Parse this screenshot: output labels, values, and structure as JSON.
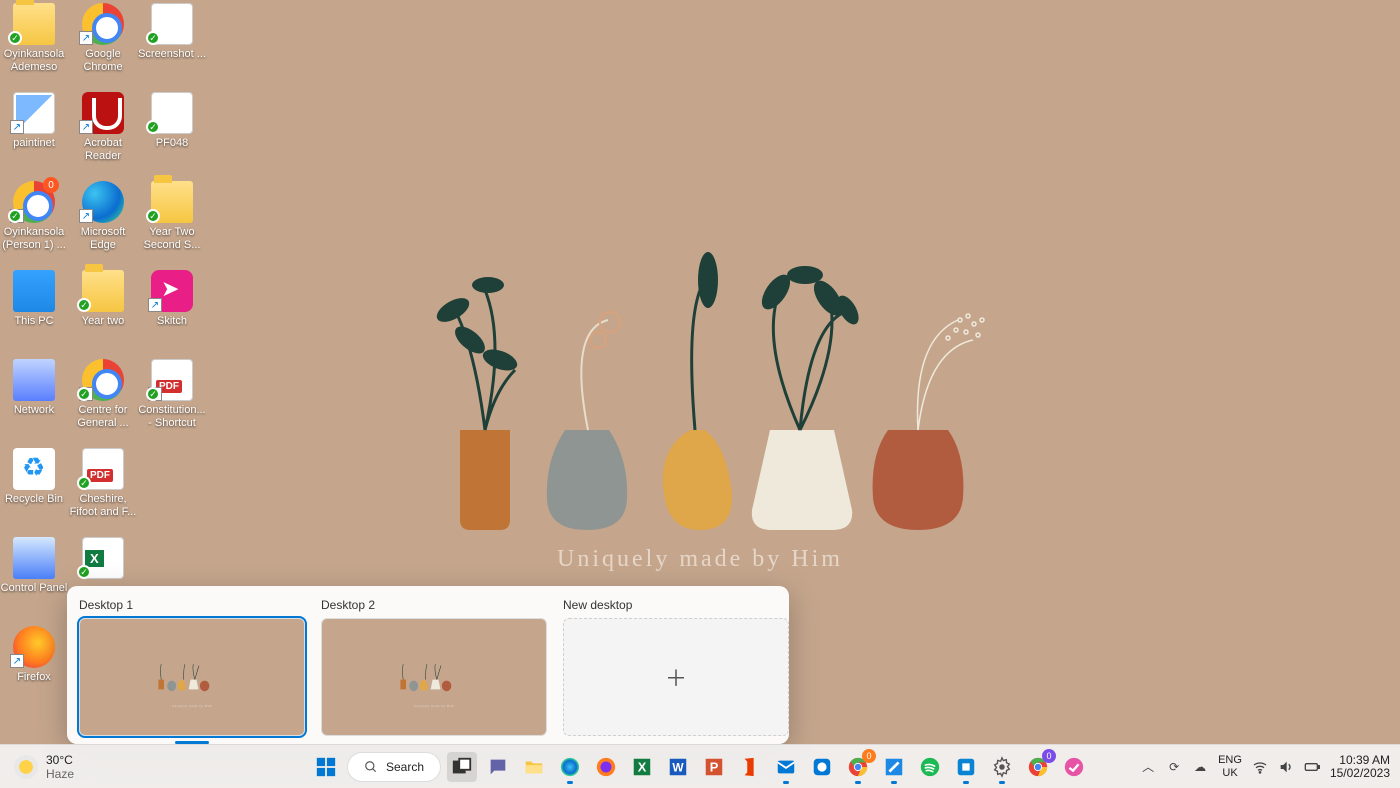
{
  "wallpaper": {
    "tagline": "Uniquely made by Him"
  },
  "desktop_icons": [
    {
      "col": 0,
      "row": 0,
      "label": "Oyinkansola Ademeso",
      "kind": "folder",
      "sync": true
    },
    {
      "col": 0,
      "row": 1,
      "label": "paintinet",
      "kind": "paint",
      "shortcut": true
    },
    {
      "col": 0,
      "row": 2,
      "label": "Oyinkansola (Person 1) ...",
      "kind": "chrome",
      "shortcut": true,
      "sync": true,
      "badge": true
    },
    {
      "col": 0,
      "row": 3,
      "label": "This PC",
      "kind": "thispc"
    },
    {
      "col": 0,
      "row": 4,
      "label": "Network",
      "kind": "network"
    },
    {
      "col": 0,
      "row": 5,
      "label": "Recycle Bin",
      "kind": "recycle"
    },
    {
      "col": 0,
      "row": 6,
      "label": "Control Panel",
      "kind": "controlpanel"
    },
    {
      "col": 0,
      "row": 7,
      "label": "Firefox",
      "kind": "firefox",
      "shortcut": true
    },
    {
      "col": 1,
      "row": 0,
      "label": "Google Chrome",
      "kind": "chrome",
      "shortcut": true
    },
    {
      "col": 1,
      "row": 1,
      "label": "Acrobat Reader",
      "kind": "acrobat",
      "shortcut": true
    },
    {
      "col": 1,
      "row": 2,
      "label": "Microsoft Edge",
      "kind": "edge",
      "shortcut": true
    },
    {
      "col": 1,
      "row": 3,
      "label": "Year two",
      "kind": "folder",
      "sync": true
    },
    {
      "col": 1,
      "row": 4,
      "label": "Centre for General ...",
      "kind": "chrome",
      "shortcut": true,
      "sync": true
    },
    {
      "col": 1,
      "row": 5,
      "label": "Cheshire, Fifoot and F...",
      "kind": "pdf",
      "sync": true
    },
    {
      "col": 1,
      "row": 6,
      "label": "",
      "kind": "excel",
      "sync": true
    },
    {
      "col": 2,
      "row": 0,
      "label": "Screenshot ...",
      "kind": "page",
      "sync": true
    },
    {
      "col": 2,
      "row": 1,
      "label": "PF048",
      "kind": "word",
      "sync": true
    },
    {
      "col": 2,
      "row": 2,
      "label": "Year Two Second S...",
      "kind": "folder",
      "sync": true
    },
    {
      "col": 2,
      "row": 3,
      "label": "Skitch",
      "kind": "skitch",
      "shortcut": true
    },
    {
      "col": 2,
      "row": 4,
      "label": "Constitution... - Shortcut",
      "kind": "pdf",
      "shortcut": true,
      "sync": true
    }
  ],
  "taskview": {
    "desktops": [
      {
        "title": "Desktop 1",
        "active": true
      },
      {
        "title": "Desktop 2",
        "active": false
      }
    ],
    "new_label": "New desktop"
  },
  "taskbar": {
    "weather_temp": "30°C",
    "weather_cond": "Haze",
    "search_placeholder": "Search",
    "apps": [
      {
        "name": "start",
        "color": "#0078d4"
      },
      {
        "name": "search"
      },
      {
        "name": "task-view",
        "active": true
      },
      {
        "name": "chat",
        "color": "#6264a7"
      },
      {
        "name": "file-explorer",
        "color": "#f6c642"
      },
      {
        "name": "edge",
        "color": "#1e88e5",
        "running": true
      },
      {
        "name": "firefox",
        "color": "#ff7c1f"
      },
      {
        "name": "excel",
        "color": "#107c41"
      },
      {
        "name": "word",
        "color": "#185abd"
      },
      {
        "name": "powerpoint",
        "color": "#d35230"
      },
      {
        "name": "office",
        "color": "#eb3c00"
      },
      {
        "name": "mail",
        "color": "#0078d4",
        "running": true
      },
      {
        "name": "tips",
        "color": "#0078d4"
      },
      {
        "name": "chrome",
        "running": true,
        "badge_o": "0"
      },
      {
        "name": "snip",
        "running": true
      },
      {
        "name": "spotify",
        "color": "#1db954"
      },
      {
        "name": "tool-blue",
        "color": "#0a84d3",
        "running": true
      },
      {
        "name": "settings",
        "color": "#555",
        "running": true
      },
      {
        "name": "chrome-2",
        "badge_p": "0"
      },
      {
        "name": "app-pink",
        "color": "#e754a6"
      }
    ],
    "lang_top": "ENG",
    "lang_bot": "UK",
    "time": "10:39 AM",
    "date": "15/02/2023"
  }
}
